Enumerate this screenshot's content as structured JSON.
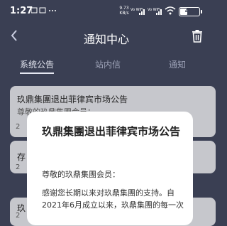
{
  "status_bar": {
    "time": "1:27",
    "net_speed_value": "9.73",
    "net_speed_unit": "KB/s",
    "sim1_label": "Vo WiFi",
    "sim2_label": "Vo WiFi",
    "battery_level": "40",
    "battery_fraction": 0.4,
    "icons": [
      "notification-icon",
      "wifi-icon",
      "battery-icon"
    ]
  },
  "header": {
    "title": "通知中心",
    "back_icon": "back-arrow-icon",
    "trash_icon": "trash-icon"
  },
  "tabs": [
    {
      "label": "系统公告",
      "active": true
    },
    {
      "label": "站内信",
      "active": false
    },
    {
      "label": "通知",
      "active": false
    }
  ],
  "notices": [
    {
      "title": "玖鼎集團退出菲律宾市场公告",
      "preview": "尊敬的玖鼎集團会员：",
      "date": "2"
    },
    {
      "title": "存",
      "preview": "",
      "date": "2"
    },
    {
      "title": "玖",
      "preview": "",
      "date": "2"
    }
  ],
  "modal": {
    "title": "玖鼎集團退出菲律宾市场公告",
    "greeting": "尊敬的玖鼎集團会员：",
    "body": "感谢您长期以来对玖鼎集團的支持。自2021年6月成立以来，玖鼎集團的每一次"
  },
  "colors": {
    "background": "#3a3f53",
    "card": "#c6c7cc",
    "modal": "#ffffff",
    "text_light": "#ffffff"
  }
}
